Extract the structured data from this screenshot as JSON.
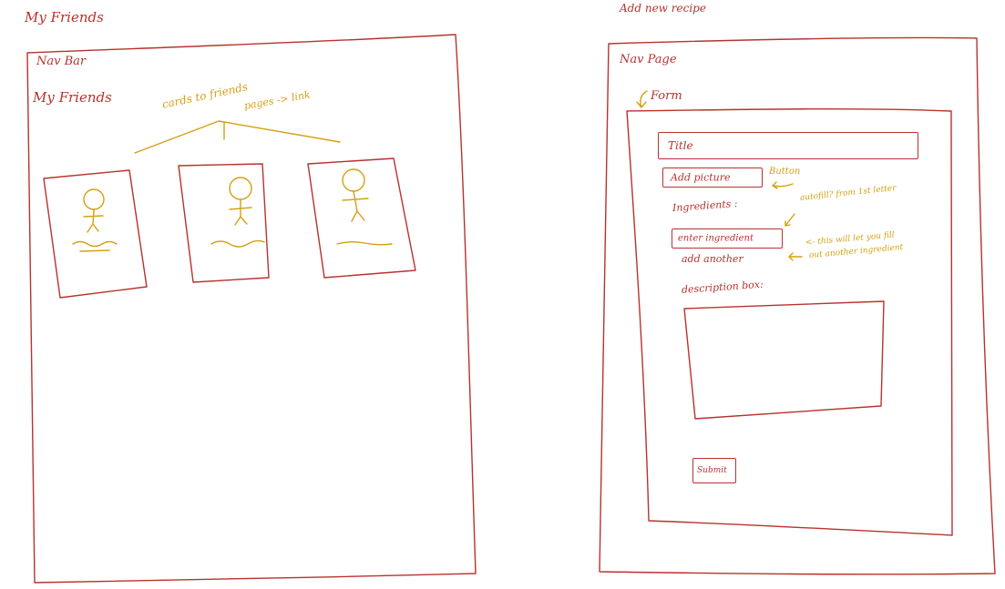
{
  "left_sketch": {
    "page_title": "My Friends",
    "nav_label": "Nav Bar",
    "heading": "My    Friends",
    "annotation_line1": "cards to friends",
    "annotation_line2": "pages -> link",
    "cards": [
      {
        "name": "friend-card-1"
      },
      {
        "name": "friend-card-2"
      },
      {
        "name": "friend-card-3"
      }
    ]
  },
  "right_sketch": {
    "page_title": "Add new recipe",
    "nav_label": "Nav    Page",
    "form_label": "Form",
    "title_field": "Title",
    "add_picture": "Add picture",
    "button_note": "Button",
    "ingredients_label": "Ingredients :",
    "autofill_note": "autofill? from 1st letter",
    "ingredient_field": "enter ingredient",
    "add_another": "add another",
    "add_another_note_line1": "<- this will let you fill",
    "add_another_note_line2": "out another ingredient",
    "description_label": "description box:",
    "submit": "Submit"
  },
  "colors": {
    "sketch_red": "#b8322e",
    "annotation_gold": "#d4a012"
  }
}
